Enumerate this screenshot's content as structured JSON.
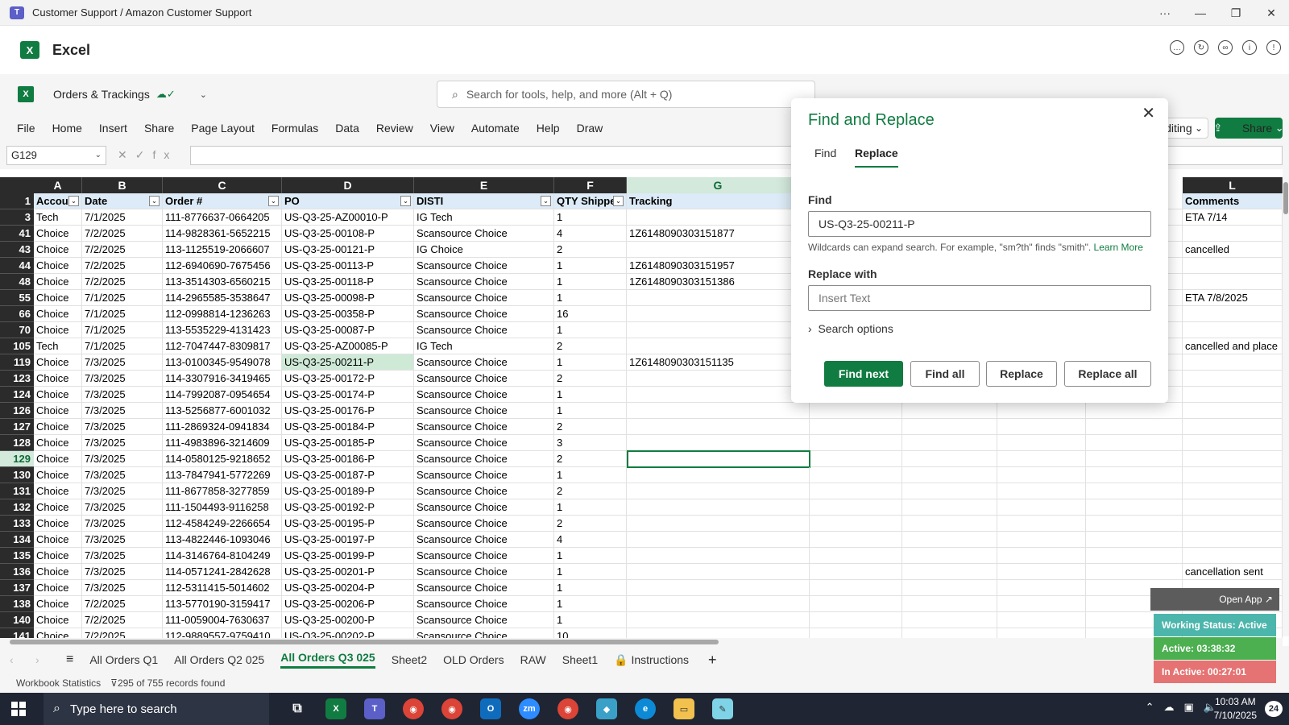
{
  "titlebar": {
    "title": "Customer Support / Amazon Customer Support",
    "more": "···",
    "minimize": "—",
    "maximize": "❐",
    "close": "✕"
  },
  "app": {
    "name": "Excel"
  },
  "excel": {
    "doc_name": "Orders & Trackings",
    "search_placeholder": "Search for tools, help, and more (Alt + Q)",
    "menu": [
      "File",
      "Home",
      "Insert",
      "Share",
      "Page Layout",
      "Formulas",
      "Data",
      "Review",
      "View",
      "Automate",
      "Help",
      "Draw"
    ],
    "editing_label": "diting",
    "share_label": "Share",
    "name_box": "G129"
  },
  "columns": [
    "A",
    "B",
    "C",
    "D",
    "E",
    "F",
    "G",
    "L"
  ],
  "header_row": {
    "row_num": "1",
    "cells": [
      "Accou",
      "Date",
      "Order #",
      "PO",
      "DISTI",
      "QTY Shippe",
      "Tracking",
      "Comments"
    ]
  },
  "rows": [
    {
      "n": "3",
      "a": "Tech",
      "b": "7/1/2025",
      "c": "111-8776637-0664205",
      "d": "US-Q3-25-AZ00010-P",
      "e": "IG Tech",
      "f": "1",
      "g": "",
      "l": "ETA 7/14"
    },
    {
      "n": "41",
      "a": "Choice",
      "b": "7/2/2025",
      "c": "114-9828361-5652215",
      "d": "US-Q3-25-00108-P",
      "e": "Scansource Choice",
      "f": "4",
      "g": "1Z6148090303151877",
      "l": ""
    },
    {
      "n": "43",
      "a": "Choice",
      "b": "7/2/2025",
      "c": "113-1125519-2066607",
      "d": "US-Q3-25-00121-P",
      "e": "IG Choice",
      "f": "2",
      "g": "",
      "l": "cancelled"
    },
    {
      "n": "44",
      "a": "Choice",
      "b": "7/2/2025",
      "c": "112-6940690-7675456",
      "d": "US-Q3-25-00113-P",
      "e": "Scansource Choice",
      "f": "1",
      "g": "1Z6148090303151957",
      "l": ""
    },
    {
      "n": "48",
      "a": "Choice",
      "b": "7/2/2025",
      "c": "113-3514303-6560215",
      "d": "US-Q3-25-00118-P",
      "e": "Scansource Choice",
      "f": "1",
      "g": "1Z6148090303151386",
      "l": ""
    },
    {
      "n": "55",
      "a": "Choice",
      "b": "7/1/2025",
      "c": "114-2965585-3538647",
      "d": "US-Q3-25-00098-P",
      "e": "Scansource Choice",
      "f": "1",
      "g": "",
      "l": "ETA 7/8/2025"
    },
    {
      "n": "66",
      "a": "Choice",
      "b": "7/1/2025",
      "c": "112-0998814-1236263",
      "d": "US-Q3-25-00358-P",
      "e": "Scansource Choice",
      "f": "16",
      "g": "",
      "l": ""
    },
    {
      "n": "70",
      "a": "Choice",
      "b": "7/1/2025",
      "c": "113-5535229-4131423",
      "d": "US-Q3-25-00087-P",
      "e": "Scansource Choice",
      "f": "1",
      "g": "",
      "l": ""
    },
    {
      "n": "105",
      "a": "Tech",
      "b": "7/1/2025",
      "c": "112-7047447-8309817",
      "d": "US-Q3-25-AZ00085-P",
      "e": "IG Tech",
      "f": "2",
      "g": "",
      "l": "cancelled and place"
    },
    {
      "n": "119",
      "a": "Choice",
      "b": "7/3/2025",
      "c": "113-0100345-9549078",
      "d": "US-Q3-25-00211-P",
      "e": "Scansource Choice",
      "f": "1",
      "g": "1Z6148090303151135",
      "l": ""
    },
    {
      "n": "123",
      "a": "Choice",
      "b": "7/3/2025",
      "c": "114-3307916-3419465",
      "d": "US-Q3-25-00172-P",
      "e": "Scansource Choice",
      "f": "2",
      "g": "",
      "l": ""
    },
    {
      "n": "124",
      "a": "Choice",
      "b": "7/3/2025",
      "c": "114-7992087-0954654",
      "d": "US-Q3-25-00174-P",
      "e": "Scansource Choice",
      "f": "1",
      "g": "",
      "l": ""
    },
    {
      "n": "126",
      "a": "Choice",
      "b": "7/3/2025",
      "c": "113-5256877-6001032",
      "d": "US-Q3-25-00176-P",
      "e": "Scansource Choice",
      "f": "1",
      "g": "",
      "l": ""
    },
    {
      "n": "127",
      "a": "Choice",
      "b": "7/3/2025",
      "c": "111-2869324-0941834",
      "d": "US-Q3-25-00184-P",
      "e": "Scansource Choice",
      "f": "2",
      "g": "",
      "l": ""
    },
    {
      "n": "128",
      "a": "Choice",
      "b": "7/3/2025",
      "c": "111-4983896-3214609",
      "d": "US-Q3-25-00185-P",
      "e": "Scansource Choice",
      "f": "3",
      "g": "",
      "l": ""
    },
    {
      "n": "129",
      "a": "Choice",
      "b": "7/3/2025",
      "c": "114-0580125-9218652",
      "d": "US-Q3-25-00186-P",
      "e": "Scansource Choice",
      "f": "2",
      "g": "",
      "l": ""
    },
    {
      "n": "130",
      "a": "Choice",
      "b": "7/3/2025",
      "c": "113-7847941-5772269",
      "d": "US-Q3-25-00187-P",
      "e": "Scansource Choice",
      "f": "1",
      "g": "",
      "l": ""
    },
    {
      "n": "131",
      "a": "Choice",
      "b": "7/3/2025",
      "c": "111-8677858-3277859",
      "d": "US-Q3-25-00189-P",
      "e": "Scansource Choice",
      "f": "2",
      "g": "",
      "l": ""
    },
    {
      "n": "132",
      "a": "Choice",
      "b": "7/3/2025",
      "c": "111-1504493-9116258",
      "d": "US-Q3-25-00192-P",
      "e": "Scansource Choice",
      "f": "1",
      "g": "",
      "l": ""
    },
    {
      "n": "133",
      "a": "Choice",
      "b": "7/3/2025",
      "c": "112-4584249-2266654",
      "d": "US-Q3-25-00195-P",
      "e": "Scansource Choice",
      "f": "2",
      "g": "",
      "l": ""
    },
    {
      "n": "134",
      "a": "Choice",
      "b": "7/3/2025",
      "c": "113-4822446-1093046",
      "d": "US-Q3-25-00197-P",
      "e": "Scansource Choice",
      "f": "4",
      "g": "",
      "l": ""
    },
    {
      "n": "135",
      "a": "Choice",
      "b": "7/3/2025",
      "c": "114-3146764-8104249",
      "d": "US-Q3-25-00199-P",
      "e": "Scansource Choice",
      "f": "1",
      "g": "",
      "l": ""
    },
    {
      "n": "136",
      "a": "Choice",
      "b": "7/3/2025",
      "c": "114-0571241-2842628",
      "d": "US-Q3-25-00201-P",
      "e": "Scansource Choice",
      "f": "1",
      "g": "",
      "l": "cancellation sent"
    },
    {
      "n": "137",
      "a": "Choice",
      "b": "7/3/2025",
      "c": "112-5311415-5014602",
      "d": "US-Q3-25-00204-P",
      "e": "Scansource Choice",
      "f": "1",
      "g": "",
      "l": ""
    },
    {
      "n": "138",
      "a": "Choice",
      "b": "7/2/2025",
      "c": "113-5770190-3159417",
      "d": "US-Q3-25-00206-P",
      "e": "Scansource Choice",
      "f": "1",
      "g": "",
      "l": ""
    },
    {
      "n": "140",
      "a": "Choice",
      "b": "7/2/2025",
      "c": "111-0059004-7630637",
      "d": "US-Q3-25-00200-P",
      "e": "Scansource Choice",
      "f": "1",
      "g": "",
      "l": ""
    },
    {
      "n": "141",
      "a": "Choice",
      "b": "7/2/2025",
      "c": "112-9889557-9759410",
      "d": "US-Q3-25-00202-P",
      "e": "Scansource Choice",
      "f": "10",
      "g": "",
      "l": ""
    }
  ],
  "selected_row": "129",
  "highlighted_row": "119",
  "sheet_tabs": [
    "All Orders Q1",
    "All Orders Q2 025",
    "All Orders Q3 025",
    "Sheet2",
    "OLD Orders",
    "RAW",
    "Sheet1",
    "Instructions"
  ],
  "active_tab": "All Orders Q3 025",
  "status": {
    "workbook": "Workbook Statistics",
    "records": "295 of 755 records found"
  },
  "dialog": {
    "title": "Find and Replace",
    "tabs": [
      "Find",
      "Replace"
    ],
    "active_tab": "Replace",
    "find_label": "Find",
    "find_value": "US-Q3-25-00211-P",
    "hint": "Wildcards can expand search. For example, \"sm?th\" finds \"smith\".",
    "learn_more": "Learn More",
    "replace_label": "Replace with",
    "replace_placeholder": "Insert Text",
    "search_options": "Search options",
    "buttons": {
      "find_next": "Find next",
      "find_all": "Find all",
      "replace": "Replace",
      "replace_all": "Replace all"
    }
  },
  "widget": {
    "open_app": "Open App ↗",
    "status": "Working Status: Active",
    "active": "Active: 03:38:32",
    "inactive": "In Active: 00:27:01",
    "colors": {
      "status": "#4db6ac",
      "active": "#4caf50",
      "inactive": "#e57373"
    }
  },
  "taskbar": {
    "search_placeholder": "Type here to search",
    "time": "10:03 AM",
    "date": "7/10/2025",
    "notifications": "24"
  }
}
